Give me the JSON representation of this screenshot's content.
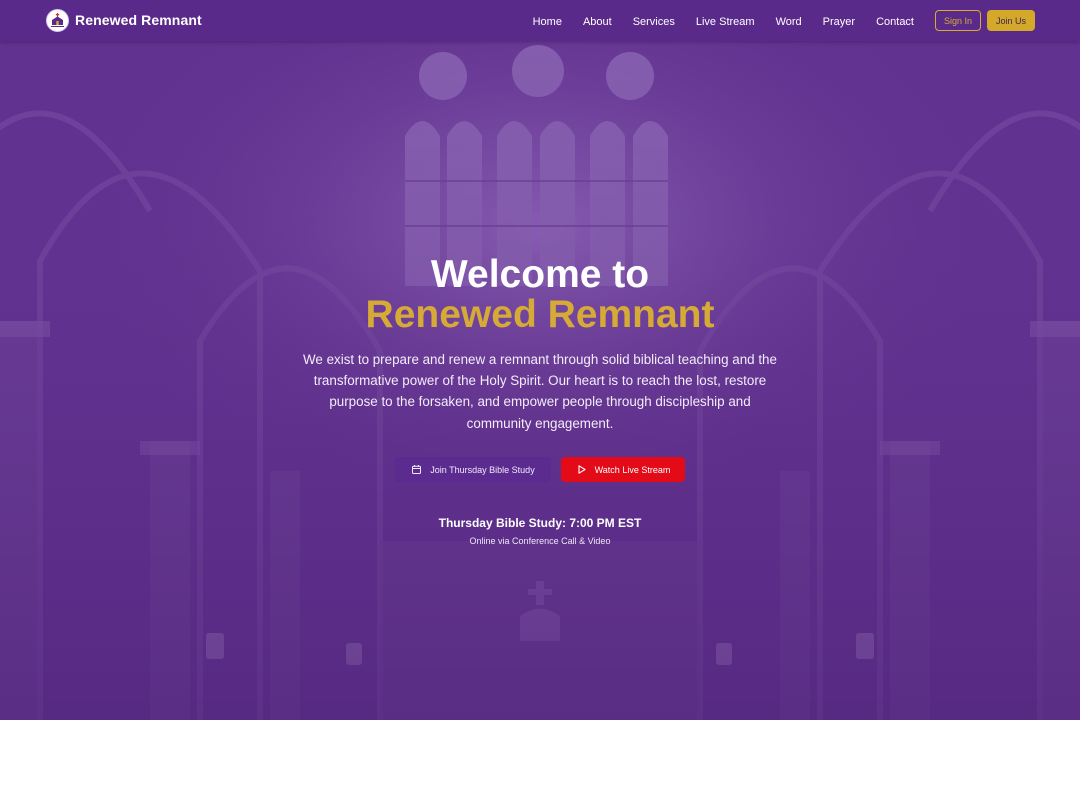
{
  "brand": {
    "name": "Renewed Remnant",
    "logo_icon": "church-logo-icon"
  },
  "nav": {
    "links": [
      "Home",
      "About",
      "Services",
      "Live Stream",
      "Word",
      "Prayer",
      "Contact"
    ],
    "sign_in": "Sign In",
    "join_us": "Join Us"
  },
  "hero": {
    "title_line1": "Welcome to",
    "title_line2": "Renewed Remnant",
    "description": "We exist to prepare and renew a remnant through solid biblical teaching and the transformative power of the Holy Spirit. Our heart is to reach the lost, restore purpose to the forsaken, and empower people through discipleship and community engagement.",
    "buttons": {
      "bible_study": {
        "label": "Join Thursday Bible Study",
        "icon": "calendar-icon"
      },
      "live_stream": {
        "label": "Watch Live Stream",
        "icon": "play-icon"
      }
    },
    "schedule_title": "Thursday Bible Study: 7:00 PM EST",
    "schedule_subtitle": "Online via Conference Call & Video"
  },
  "colors": {
    "nav_bg": "#5a2a8a",
    "accent_gold": "#d6aa36",
    "live_red": "#e20b17",
    "hero_overlay": "#5d2f88"
  }
}
